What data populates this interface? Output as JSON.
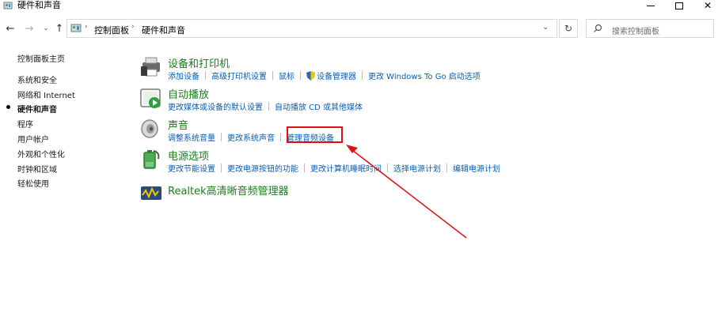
{
  "window": {
    "title": "硬件和声音"
  },
  "navigation": {
    "breadcrumbs": [
      "控制面板",
      "硬件和声音"
    ],
    "search_placeholder": "搜索控制面板"
  },
  "sidebar": {
    "items": [
      {
        "label": "控制面板主页",
        "active": false
      },
      {
        "label": "系统和安全",
        "active": false
      },
      {
        "label": "网络和 Internet",
        "active": false
      },
      {
        "label": "硬件和声音",
        "active": true
      },
      {
        "label": "程序",
        "active": false
      },
      {
        "label": "用户帐户",
        "active": false
      },
      {
        "label": "外观和个性化",
        "active": false
      },
      {
        "label": "时钟和区域",
        "active": false
      },
      {
        "label": "轻松使用",
        "active": false
      }
    ]
  },
  "categories": [
    {
      "title": "设备和打印机",
      "icon": "printer-icon",
      "links": [
        "添加设备",
        "高级打印机设置",
        "鼠标",
        "设备管理器",
        "更改 Windows To Go 启动选项"
      ]
    },
    {
      "title": "自动播放",
      "icon": "autoplay-icon",
      "links": [
        "更改媒体或设备的默认设置",
        "自动播放 CD 或其他媒体"
      ]
    },
    {
      "title": "声音",
      "icon": "speaker-icon",
      "links": [
        "调整系统音量",
        "更改系统声音",
        "管理音频设备"
      ]
    },
    {
      "title": "电源选项",
      "icon": "battery-icon",
      "links": [
        "更改节能设置",
        "更改电源按钮的功能",
        "更改计算机睡眠时间",
        "选择电源计划",
        "编辑电源计划"
      ]
    },
    {
      "title": "Realtek高清晰音频管理器",
      "icon": "realtek-icon",
      "links": []
    }
  ],
  "annotation": {
    "highlight_color": "#dd1111",
    "highlighted_link": "管理音频设备"
  },
  "colors": {
    "category_title": "#1e7a1e",
    "link": "#0b5dad"
  }
}
